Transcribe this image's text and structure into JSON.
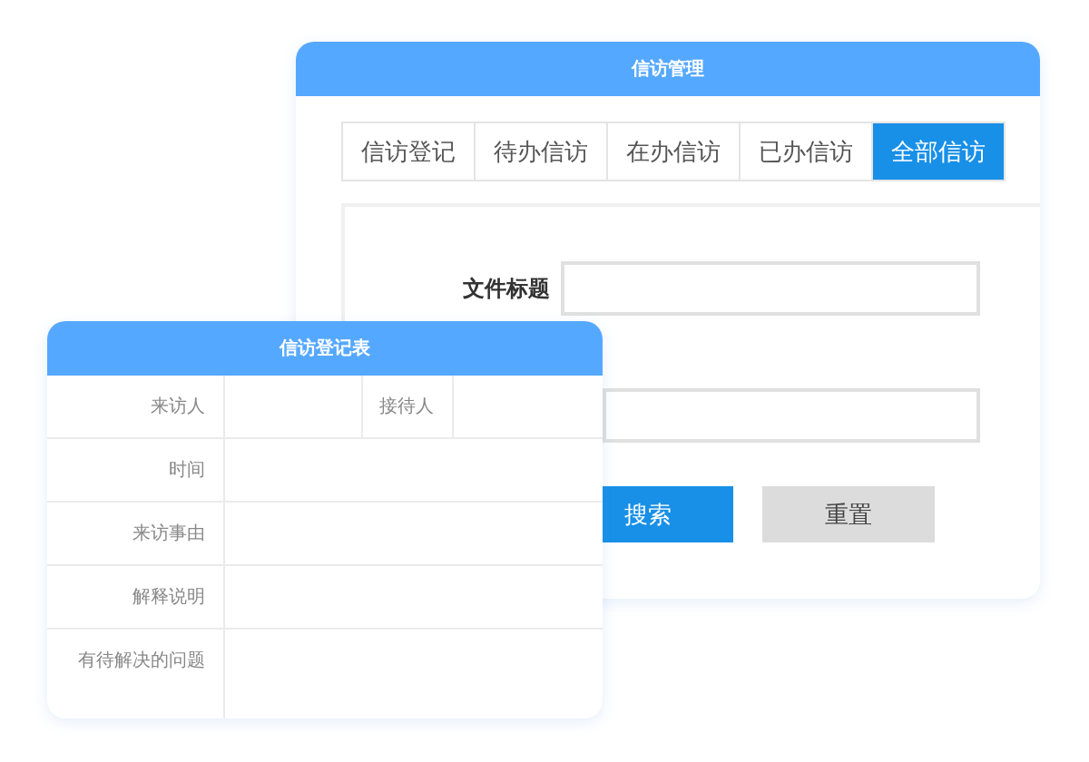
{
  "management_window": {
    "title": "信访管理",
    "tabs": [
      {
        "label": "信访登记",
        "selected": false
      },
      {
        "label": "待办信访",
        "selected": false
      },
      {
        "label": "在办信访",
        "selected": false
      },
      {
        "label": "已办信访",
        "selected": false
      },
      {
        "label": "全部信访",
        "selected": true
      }
    ],
    "fields": [
      {
        "label": "文件标题",
        "kind": "labeled"
      },
      {
        "kind": "label_covered"
      }
    ],
    "buttons": [
      {
        "label": "搜索",
        "kind": "primary"
      },
      {
        "label": "重置",
        "kind": "secondary"
      }
    ]
  },
  "form_window": {
    "title": "信访登记表",
    "rows": [
      {
        "cells": [
          "来访人",
          "",
          "接待人",
          ""
        ]
      },
      {
        "cells": [
          "时间",
          ""
        ]
      },
      {
        "cells": [
          "来访事由",
          ""
        ]
      },
      {
        "cells": [
          "解释说明",
          ""
        ]
      },
      {
        "cells": [
          "有待解决的问题",
          ""
        ]
      }
    ]
  }
}
